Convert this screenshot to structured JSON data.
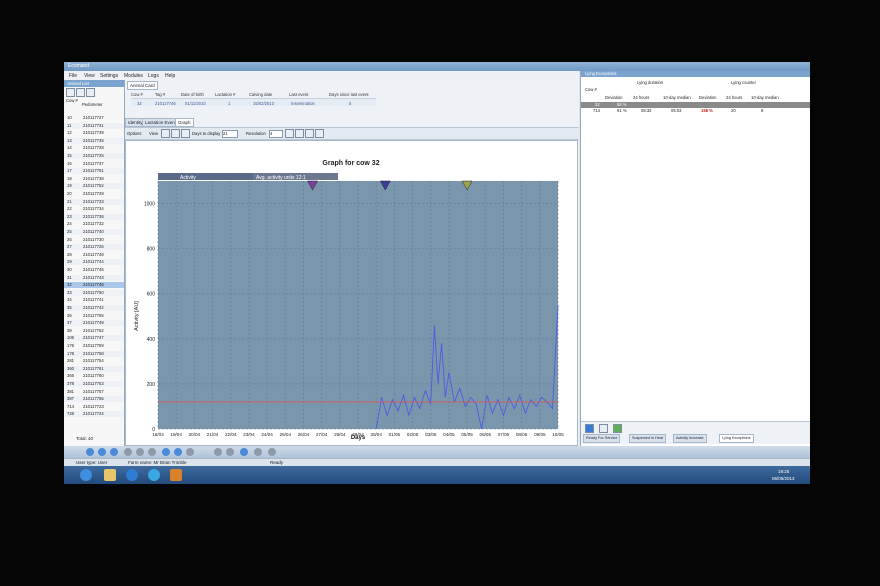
{
  "app": {
    "title": "Ecomand"
  },
  "menu": [
    "File",
    "View",
    "Settings",
    "Modules",
    "Logs",
    "Help"
  ],
  "left_panel": {
    "title": "Animal List",
    "columns": [
      "Cow #",
      "Pedometer"
    ],
    "rows": [
      [
        "10",
        "210117727"
      ],
      [
        "11",
        "210117731"
      ],
      [
        "12",
        "210117739"
      ],
      [
        "13",
        "210117735"
      ],
      [
        "14",
        "210117728"
      ],
      [
        "15",
        "210117725"
      ],
      [
        "16",
        "210117737"
      ],
      [
        "17",
        "210117751"
      ],
      [
        "18",
        "210117738"
      ],
      [
        "19",
        "210117752"
      ],
      [
        "20",
        "210117729"
      ],
      [
        "21",
        "210117733"
      ],
      [
        "22",
        "210117734"
      ],
      [
        "23",
        "210117736"
      ],
      [
        "24",
        "210117732"
      ],
      [
        "25",
        "210117740"
      ],
      [
        "26",
        "210117730"
      ],
      [
        "27",
        "210117726"
      ],
      [
        "28",
        "210117748"
      ],
      [
        "29",
        "210117744"
      ],
      [
        "30",
        "210117745"
      ],
      [
        "31",
        "210117743"
      ],
      [
        "32",
        "210117746"
      ],
      [
        "33",
        "210117750"
      ],
      [
        "34",
        "210117741"
      ],
      [
        "35",
        "210117742"
      ],
      [
        "36",
        "210117755"
      ],
      [
        "37",
        "210117749"
      ],
      [
        "38",
        "210117762"
      ],
      [
        "106",
        "210117747"
      ],
      [
        "176",
        "210117759"
      ],
      [
        "178",
        "210117758"
      ],
      [
        "281",
        "210117754"
      ],
      [
        "360",
        "210117761"
      ],
      [
        "365",
        "210117760"
      ],
      [
        "378",
        "210117753"
      ],
      [
        "381",
        "210117757"
      ],
      [
        "387",
        "210117756"
      ],
      [
        "714",
        "210117723"
      ],
      [
        "726",
        "210117724"
      ]
    ],
    "selected_index": 22,
    "total": "Total: 40"
  },
  "animal_card": {
    "tab": "Animal Card",
    "headers": [
      "Cow #",
      "Tag #",
      "Date of birth",
      "Lactation #",
      "Calving date",
      "Last event",
      "Days since last event"
    ],
    "values": [
      "32",
      "210117746",
      "01/11/2010",
      "1",
      "15/02/2013",
      "Insemination",
      "5"
    ]
  },
  "subtabs": [
    "Identity",
    "Lactation Events",
    "Graph"
  ],
  "graph_toolbar": {
    "options": "Options",
    "view": "View",
    "days_label": "Days to display",
    "days_value": "21",
    "resolution_label": "Resolution",
    "resolution_value": "4"
  },
  "chart_data": {
    "type": "line",
    "title": "Graph for cow 32",
    "legend": [
      "Activity",
      "Avg. activity units 12:1"
    ],
    "xlabel": "Days",
    "ylabel": "Activity [AU]",
    "ylim": [
      0,
      1100
    ],
    "yticks": [
      0,
      200,
      400,
      600,
      800,
      1000
    ],
    "categories": [
      "16/04",
      "19/04",
      "20/04",
      "21/04",
      "22/04",
      "23/04",
      "24/04",
      "25/04",
      "26/04",
      "27/04",
      "28/04",
      "29/04",
      "30/04",
      "01/05",
      "02/05",
      "03/05",
      "04/05",
      "05/05",
      "06/05",
      "07/05",
      "08/05",
      "09/05",
      "10/05"
    ],
    "series": [
      {
        "name": "Activity",
        "color": "#4a5ee0",
        "x": [
          12.0,
          12.3,
          12.6,
          12.9,
          13.2,
          13.5,
          13.8,
          14.1,
          14.4,
          14.7,
          15.0,
          15.2,
          15.4,
          15.6,
          15.8,
          16.0,
          16.3,
          16.6,
          16.9,
          17.2,
          17.5,
          17.8,
          18.1,
          18.4,
          18.7,
          19.0,
          19.3,
          19.6,
          19.9,
          20.2,
          20.5,
          20.8,
          21.1,
          21.4,
          21.7,
          22.0
        ],
        "y": [
          0,
          140,
          60,
          130,
          80,
          150,
          60,
          140,
          90,
          170,
          110,
          460,
          200,
          380,
          140,
          250,
          120,
          180,
          100,
          140,
          110,
          0,
          150,
          70,
          130,
          60,
          140,
          90,
          150,
          70,
          130,
          100,
          140,
          120,
          90,
          550
        ]
      },
      {
        "name": "Avg. activity units 12:1",
        "color": "#d05a5a",
        "x": [
          0,
          22
        ],
        "y": [
          120,
          120
        ]
      }
    ],
    "markers": [
      {
        "x": 8.5,
        "color": "#7b3fa0"
      },
      {
        "x": 12.5,
        "color": "#3e3d9a"
      },
      {
        "x": 17.0,
        "color": "#9aa44a"
      }
    ],
    "grid": true
  },
  "right_panel": {
    "title": "Lying Exceptions",
    "group1": "Lying duration",
    "group2": "Lying counter",
    "columns": [
      "Cow #",
      "Deviation",
      "24 hours",
      "10-day median",
      "Deviation",
      "24 hours",
      "10-day median"
    ],
    "rows": [
      [
        "32",
        "58 %",
        "",
        "",
        "",
        "",
        ""
      ],
      [
        "714",
        "91 %",
        "08:32",
        "05:03",
        "158 %",
        "20",
        "8"
      ]
    ],
    "tabs": [
      "Ready For Service",
      "Suspected in Heat",
      "Activity Increase",
      "Lying Exceptions"
    ]
  },
  "statusbar": {
    "user": "User type: User",
    "farm": "Farm name: Mr Brian Trimble",
    "status": "Ready"
  },
  "taskbar": {
    "time": "19:25",
    "date": "06/05/2013"
  }
}
